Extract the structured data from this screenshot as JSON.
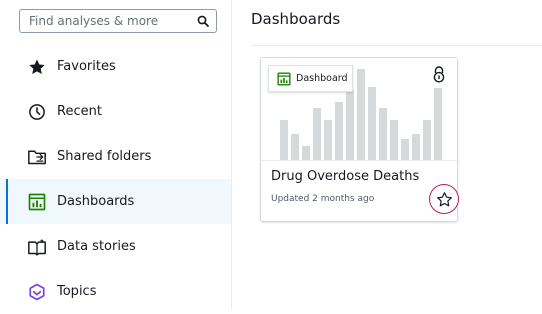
{
  "search": {
    "placeholder": "Find analyses & more",
    "icon": "search-icon"
  },
  "sidebar": {
    "items": [
      {
        "label": "Favorites",
        "icon": "star-filled-icon"
      },
      {
        "label": "Recent",
        "icon": "clock-icon"
      },
      {
        "label": "Shared folders",
        "icon": "shared-folder-icon"
      },
      {
        "label": "Dashboards",
        "icon": "dashboard-icon",
        "active": true
      },
      {
        "label": "Data stories",
        "icon": "book-sparkle-icon"
      },
      {
        "label": "Topics",
        "icon": "topics-icon"
      }
    ]
  },
  "main": {
    "title": "Dashboards",
    "cards": [
      {
        "tag_label": "Dashboard",
        "title": "Drug Overdose Deaths",
        "updated": "Updated 2 months ago"
      }
    ]
  },
  "colors": {
    "accent": "#0972d3",
    "dashboard_green": "#1d8102",
    "topics_purple": "#7b3fe4",
    "highlight_ring": "#c2185b"
  }
}
